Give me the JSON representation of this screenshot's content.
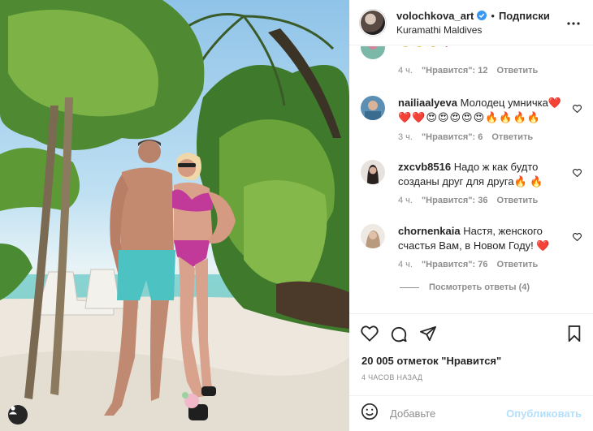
{
  "post": {
    "username": "volochkova_art",
    "follow_label": "Подписки",
    "separator": "•",
    "location": "Kuramathi Maldives"
  },
  "comments": [
    {
      "username": "",
      "text": "",
      "emoji": "👏👏👏❤️",
      "time": "4 ч.",
      "likes": "\"Нравится\": 12",
      "reply": "Ответить"
    },
    {
      "username": "nailiaalyeva",
      "text": "Молодец умничка❤️",
      "emoji": "❤️❤️😍😍😍😍😍🔥🔥🔥🔥",
      "time": "3 ч.",
      "likes": "\"Нравится\": 6",
      "reply": "Ответить"
    },
    {
      "username": "zxcvb8516",
      "text": "Надо ж как будто созданы друг для друга🔥 🔥",
      "time": "4 ч.",
      "likes": "\"Нравится\": 36",
      "reply": "Ответить"
    },
    {
      "username": "chornenkaia",
      "text": "Настя, женского счастья Вам, в Новом Году! ❤️",
      "time": "4 ч.",
      "likes": "\"Нравится\": 76",
      "reply": "Ответить"
    }
  ],
  "more_replies": "Посмотреть ответы (4)",
  "likes_count": "20 005 отметок \"Нравится\"",
  "timestamp": "4 ЧАСОВ НАЗАД",
  "comment_box": {
    "placeholder": "Добавьте",
    "publish_label": "Опубликовать"
  },
  "icons": {
    "verified": "verified-badge-icon",
    "more": "more-options-icon",
    "like": "heart-icon",
    "comment": "comment-icon",
    "share": "share-icon",
    "save": "bookmark-icon",
    "emoji": "smile-icon",
    "tag": "user-tag-icon"
  },
  "colors": {
    "verified_blue": "#3897f0",
    "muted_text": "#8e8e8e",
    "publish_disabled": "#b2dffc",
    "primary_text": "#262626"
  }
}
